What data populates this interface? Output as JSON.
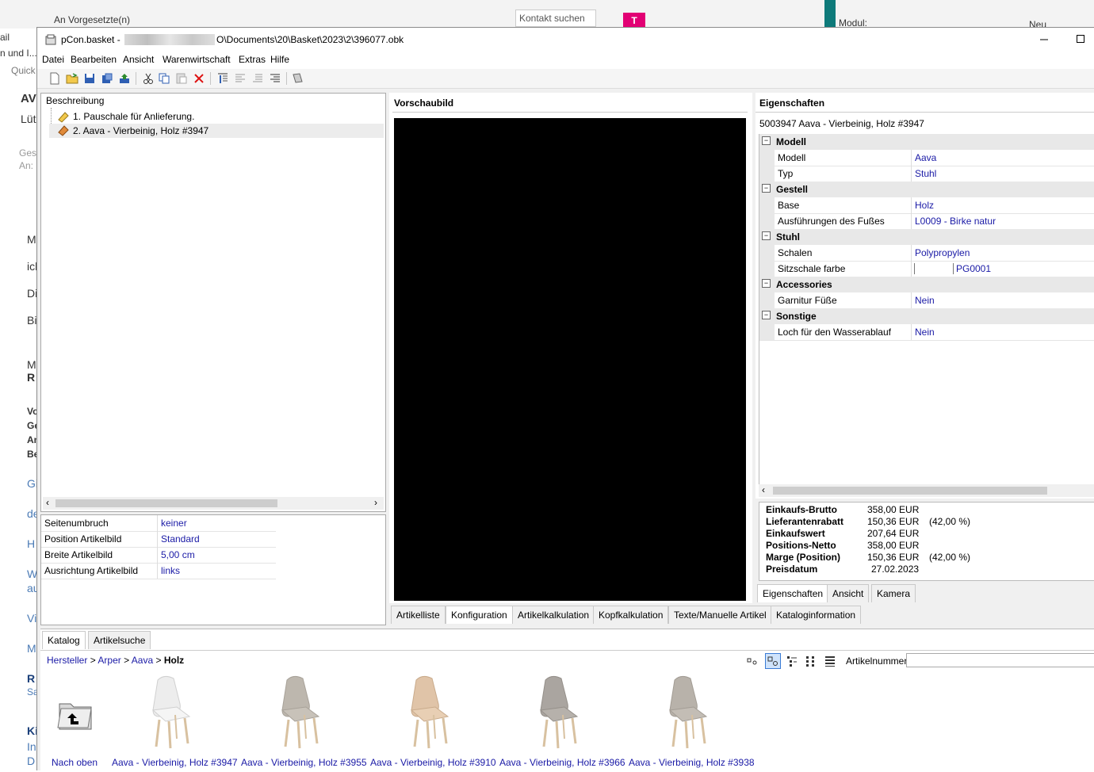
{
  "background": {
    "top_items": [
      "An Vorgesetzte(n)",
      "Kontakt suchen",
      "Modul:",
      "Neu"
    ],
    "left_fragments": [
      "ail",
      "n und I...",
      "Quick",
      "AV",
      "Lüt",
      "Gese",
      "An:",
      "M",
      "ich",
      "Di",
      "Bi",
      "M",
      "R",
      "Vo",
      "Ge",
      "An",
      "Be",
      "Gi",
      "de",
      "H",
      "W",
      "au",
      "Vi",
      "M",
      "R",
      "Sa",
      "Ki",
      "In",
      "D"
    ]
  },
  "window": {
    "app_name": "pCon.basket -",
    "path": "O\\Documents\\20\\Basket\\2023\\2\\396077.obk"
  },
  "menu": [
    "Datei",
    "Bearbeiten",
    "Ansicht",
    "Warenwirtschaft",
    "Extras",
    "Hilfe"
  ],
  "toolbar_icons": [
    "new-icon",
    "open-icon",
    "save-icon",
    "save-as-icon",
    "export-icon",
    "cut-icon",
    "copy-icon",
    "paste-icon",
    "delete-icon",
    "align-top-icon",
    "align-icon",
    "indent-icon",
    "outdent-icon",
    "book-icon"
  ],
  "tree": {
    "header": "Beschreibung",
    "items": [
      {
        "label": "1. Pauschale für Anlieferung."
      },
      {
        "label": "2. Aava - Vierbeinig, Holz #3947"
      }
    ]
  },
  "article_settings": [
    {
      "label": "Seitenumbruch",
      "value": "keiner"
    },
    {
      "label": "Position Artikelbild",
      "value": "Standard"
    },
    {
      "label": "Breite Artikelbild",
      "value": "5,00 cm"
    },
    {
      "label": "Ausrichtung Artikelbild",
      "value": "links"
    }
  ],
  "preview": {
    "header": "Vorschaubild"
  },
  "center_tabs": [
    "Artikelliste",
    "Konfiguration",
    "Artikelkalkulation",
    "Kopfkalkulation",
    "Texte/Manuelle Artikel",
    "Kataloginformation"
  ],
  "properties": {
    "header": "Eigenschaften",
    "subtitle": "5003947  Aava - Vierbeinig, Holz #3947",
    "groups": [
      {
        "name": "Modell",
        "rows": [
          {
            "label": "Modell",
            "value": "Aava"
          },
          {
            "label": "Typ",
            "value": "Stuhl"
          }
        ]
      },
      {
        "name": "Gestell",
        "rows": [
          {
            "label": "Base",
            "value": "Holz"
          },
          {
            "label": "Ausführungen des Fußes",
            "value": "L0009 - Birke natur"
          }
        ]
      },
      {
        "name": "Stuhl",
        "rows": [
          {
            "label": "Schalen",
            "value": "Polypropylen"
          },
          {
            "label": "Sitzschale farbe",
            "value": "PG0001"
          }
        ]
      },
      {
        "name": "Accessories",
        "rows": [
          {
            "label": "Garnitur Füße",
            "value": "Nein"
          }
        ]
      },
      {
        "name": "Sonstige",
        "rows": [
          {
            "label": "Loch für den Wasserablauf",
            "value": "Nein"
          }
        ]
      }
    ]
  },
  "pricing": [
    {
      "label": "Einkaufs-Brutto",
      "value": "358,00 EUR",
      "pct": ""
    },
    {
      "label": "Lieferantenrabatt",
      "value": "150,36 EUR",
      "pct": "(42,00 %)"
    },
    {
      "label": "Einkaufswert",
      "value": "207,64 EUR",
      "pct": ""
    },
    {
      "label": "Positions-Netto",
      "value": "358,00 EUR",
      "pct": ""
    },
    {
      "label": "Marge (Position)",
      "value": "150,36 EUR",
      "pct": "(42,00 %)"
    },
    {
      "label": "Preisdatum",
      "value": "27.02.2023",
      "pct": ""
    }
  ],
  "right_tabs": [
    "Eigenschaften",
    "Ansicht",
    "Kamera"
  ],
  "catalog": {
    "tabs": [
      "Katalog",
      "Artikelsuche"
    ],
    "breadcrumb": [
      "Hersteller",
      ">",
      "Arper",
      ">",
      "Aava",
      ">",
      "Holz"
    ],
    "search_label": "Artikelnummer:",
    "search_value": "",
    "items": [
      {
        "label": "Nach oben",
        "icon": "folder-up-icon"
      },
      {
        "label": "Aava - Vierbeinig, Holz #3947",
        "color": "#ededed"
      },
      {
        "label": "Aava - Vierbeinig, Holz #3955",
        "color": "#bdb7ae"
      },
      {
        "label": "Aava - Vierbeinig, Holz #3910",
        "color": "#e0c4a8"
      },
      {
        "label": "Aava - Vierbeinig, Holz #3966",
        "color": "#aaa5a0"
      },
      {
        "label": "Aava - Vierbeinig, Holz #3938",
        "color": "#b8b2aa"
      }
    ]
  }
}
